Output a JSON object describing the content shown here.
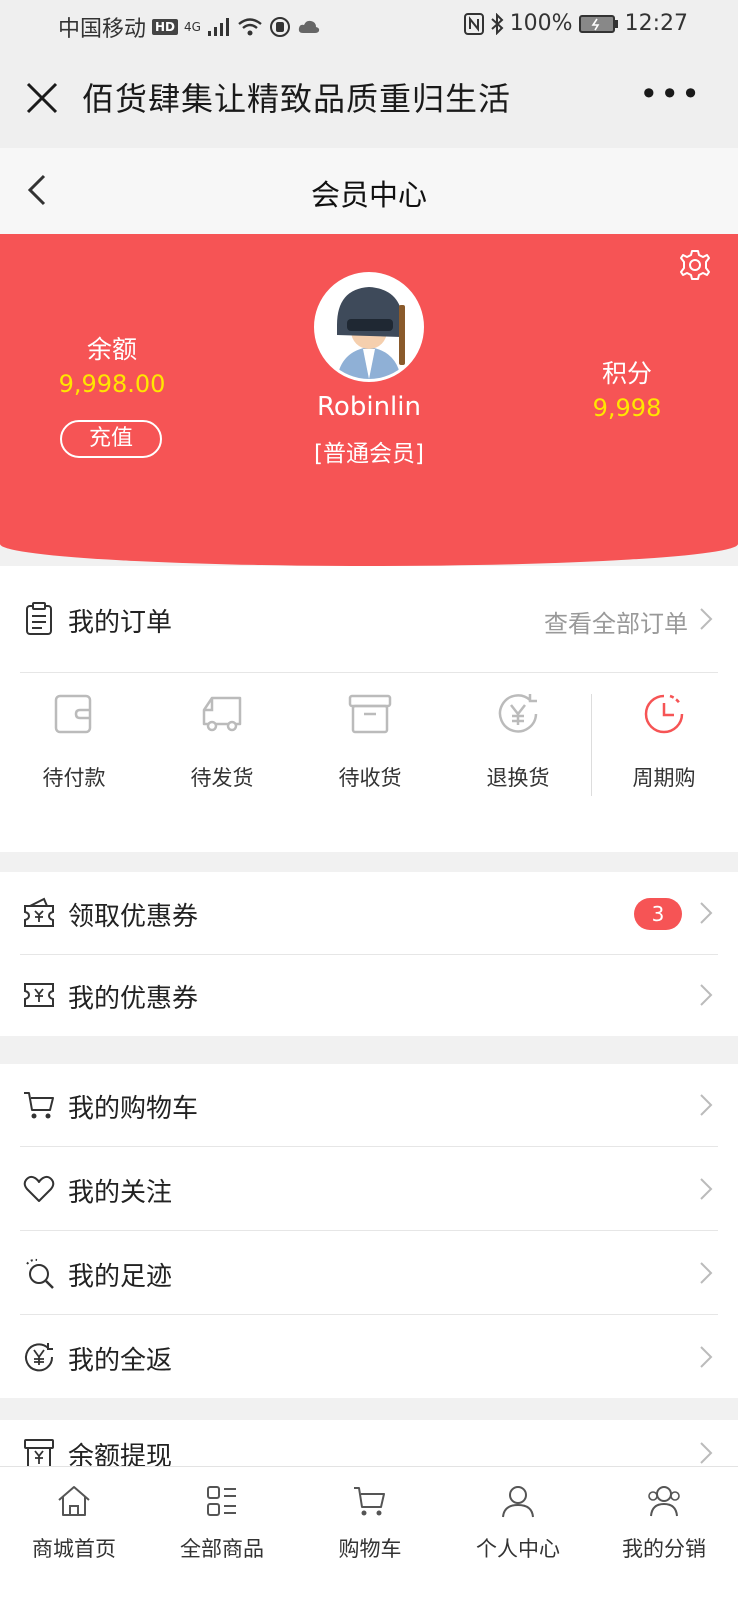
{
  "status_bar": {
    "carrier": "中国移动",
    "hd": "HD",
    "network": "4G",
    "battery": "100%",
    "time": "12:27"
  },
  "webview": {
    "title": "佰货肆集让精致品质重归生活"
  },
  "navbar": {
    "title": "会员中心"
  },
  "header": {
    "balance_label": "余额",
    "balance_value": "9,998.00",
    "recharge_label": "充值",
    "username": "Robinlin",
    "member_level": "[普通会员]",
    "points_label": "积分",
    "points_value": "9,998",
    "colors": {
      "background": "#f65455",
      "value_text": "#ffe600"
    }
  },
  "orders": {
    "title": "我的订单",
    "view_all": "查看全部订单",
    "tabs": [
      {
        "label": "待付款",
        "icon": "wallet-icon"
      },
      {
        "label": "待发货",
        "icon": "truck-icon"
      },
      {
        "label": "待收货",
        "icon": "box-icon"
      },
      {
        "label": "退换货",
        "icon": "yen-return-icon"
      },
      {
        "label": "周期购",
        "icon": "clock-icon"
      }
    ]
  },
  "coupons": {
    "items": [
      {
        "label": "领取优惠券",
        "icon": "coupon-receive-icon",
        "badge": "3"
      },
      {
        "label": "我的优惠券",
        "icon": "coupon-icon"
      }
    ]
  },
  "menu": {
    "items": [
      {
        "label": "我的购物车",
        "icon": "cart-icon"
      },
      {
        "label": "我的关注",
        "icon": "heart-icon"
      },
      {
        "label": "我的足迹",
        "icon": "footprint-icon"
      },
      {
        "label": "我的全返",
        "icon": "yen-circle-icon"
      }
    ]
  },
  "withdraw": {
    "label": "余额提现",
    "icon": "withdraw-icon"
  },
  "tabbar": {
    "items": [
      {
        "label": "商城首页",
        "icon": "home-icon"
      },
      {
        "label": "全部商品",
        "icon": "grid-list-icon"
      },
      {
        "label": "购物车",
        "icon": "cart-icon"
      },
      {
        "label": "个人中心",
        "icon": "user-icon"
      },
      {
        "label": "我的分销",
        "icon": "group-icon"
      }
    ]
  }
}
